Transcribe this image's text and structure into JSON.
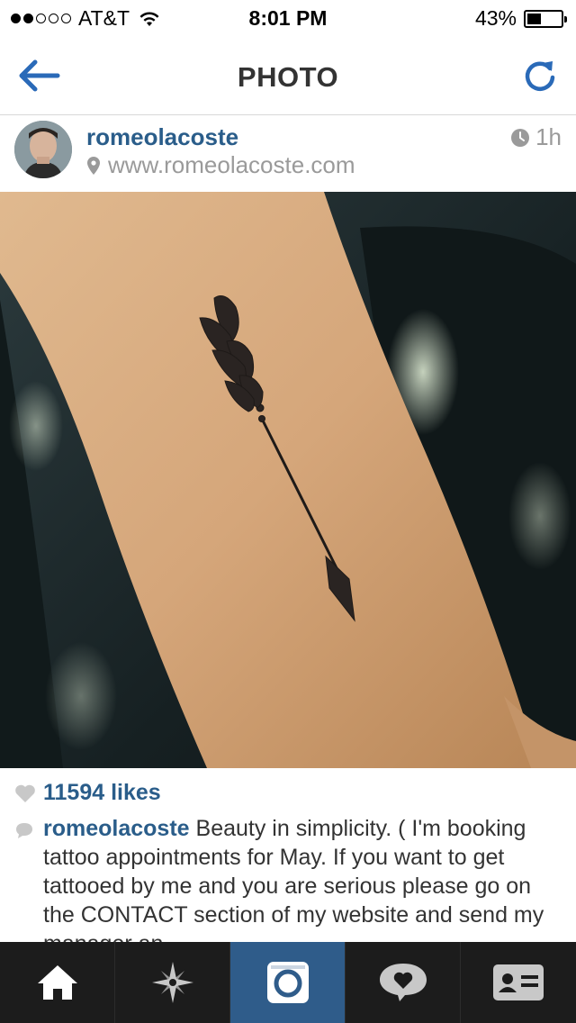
{
  "status_bar": {
    "carrier": "AT&T",
    "time": "8:01 PM",
    "battery_percent": "43%",
    "battery_level": 0.43,
    "signal_bars": 2,
    "signal_total": 5
  },
  "nav": {
    "title": "PHOTO",
    "back_icon": "back-arrow-icon",
    "refresh_icon": "refresh-icon",
    "accent": "#2a6ab8"
  },
  "post": {
    "username": "romeolacoste",
    "location": "www.romeolacoste.com",
    "time_ago": "1h",
    "likes": "11594 likes",
    "caption_user": "romeolacoste",
    "caption_text": "Beauty in simplicity. ( I'm booking tattoo appointments for May. If you want to get tattooed by me and you are serious please go on the CONTACT section of my website and send my manager an"
  },
  "tab_bar": {
    "tabs": [
      {
        "name": "home",
        "icon": "home-icon"
      },
      {
        "name": "explore",
        "icon": "explore-star-icon"
      },
      {
        "name": "camera",
        "icon": "camera-icon"
      },
      {
        "name": "activity",
        "icon": "heart-bubble-icon"
      },
      {
        "name": "profile",
        "icon": "profile-card-icon"
      }
    ]
  },
  "colors": {
    "link_blue": "#2a5d8a",
    "tab_bar_bg": "#1c1c1c",
    "tab_active_bg": "#2f5c8a"
  }
}
